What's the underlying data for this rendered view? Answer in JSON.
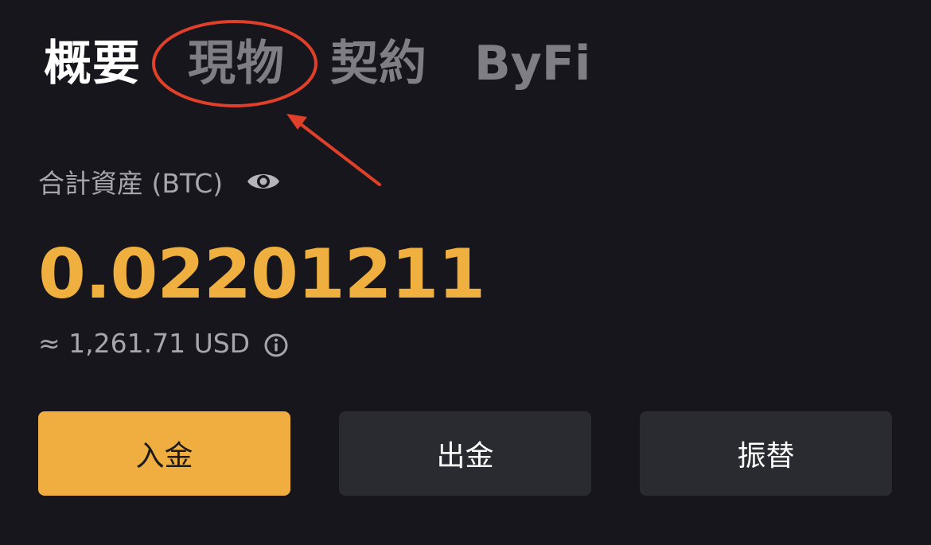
{
  "tabs": [
    {
      "label": "概要",
      "active": true
    },
    {
      "label": "現物",
      "active": false
    },
    {
      "label": "契約",
      "active": false
    },
    {
      "label": "ByFi",
      "active": false
    }
  ],
  "asset": {
    "label": "合計資産 (BTC)",
    "balance": "0.02201211",
    "usd_value": "≈  1,261.71 USD",
    "visibility_icon": "eye-icon",
    "info_icon": "info-icon"
  },
  "actions": {
    "deposit": "入金",
    "withdraw": "出金",
    "transfer": "振替"
  },
  "colors": {
    "background": "#17161c",
    "accent": "#efae3f",
    "button_dark": "#2a2a31",
    "annotation": "#e0402a"
  }
}
